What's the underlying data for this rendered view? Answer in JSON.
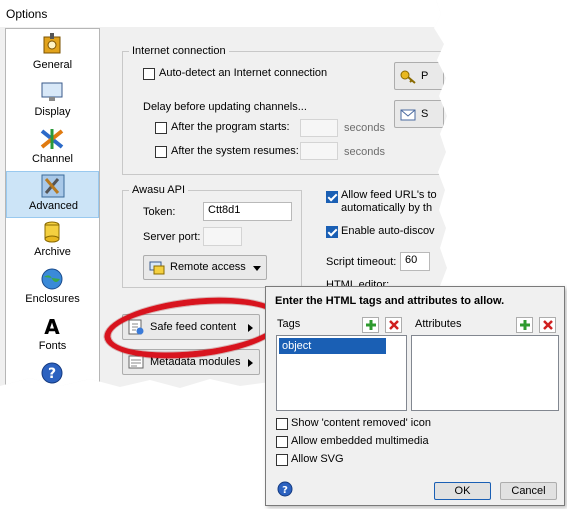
{
  "window": {
    "title": "Options"
  },
  "sidebar": {
    "items": [
      {
        "label": "General",
        "icon": "general-icon"
      },
      {
        "label": "Display",
        "icon": "display-icon"
      },
      {
        "label": "Channel",
        "icon": "channel-icon"
      },
      {
        "label": "Advanced",
        "icon": "advanced-icon",
        "selected": true
      },
      {
        "label": "Archive",
        "icon": "archive-icon"
      },
      {
        "label": "Enclosures",
        "icon": "enclosures-icon"
      },
      {
        "label": "Fonts",
        "icon": "fonts-icon"
      },
      {
        "label": "",
        "icon": "help-icon"
      }
    ]
  },
  "internet": {
    "group_label": "Internet connection",
    "autodetect_label": "Auto-detect an Internet connection",
    "delay_label": "Delay before updating channels...",
    "after_start_label": "After the program starts:",
    "after_resume_label": "After the system resumes:",
    "seconds_1": "seconds",
    "seconds_2": "seconds",
    "proxy_btn_partial": "P",
    "second_btn_partial": "S"
  },
  "api": {
    "group_label": "Awasu API",
    "token_label": "Token:",
    "token_value": "Ctt8d1",
    "server_port_label": "Server port:",
    "server_port_value": "",
    "remote_access_label": "Remote access"
  },
  "right_options": {
    "allow_feed_urls_line1": "Allow feed URL's to",
    "allow_feed_urls_line2": "automatically by th",
    "enable_auto_label": "Enable auto-discov",
    "script_timeout_label": "Script timeout:",
    "script_timeout_value": "60",
    "html_editor_label": "HTML editor:"
  },
  "buttons": {
    "safe_feed_label": "Safe feed content",
    "metadata_label": "Metadata modules"
  },
  "popup": {
    "heading": "Enter the HTML tags and attributes to allow.",
    "tags_label": "Tags",
    "attributes_label": "Attributes",
    "tags": [
      "object"
    ],
    "attributes": [],
    "show_removed_label": "Show 'content removed' icon",
    "allow_multimedia_label": "Allow embedded multimedia",
    "allow_svg_label": "Allow SVG",
    "ok_label": "OK",
    "cancel_label": "Cancel"
  },
  "colors": {
    "accent": "#1a5fb4",
    "selection": "#cce4f7",
    "highlight_ring": "#d8141e",
    "add_green": "#2e9a2e",
    "delete_red": "#d02020"
  }
}
